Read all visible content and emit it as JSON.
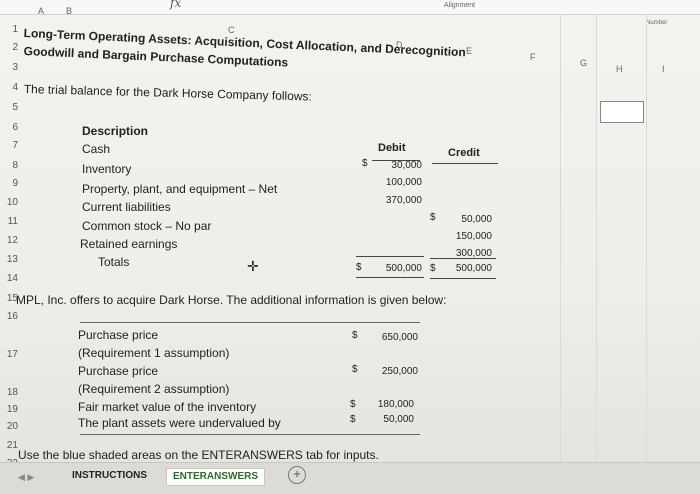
{
  "ribbon": {
    "formula_label": "fx",
    "alignment_label": "Alignment",
    "number_label": "Number"
  },
  "columns": [
    "A",
    "B",
    "C",
    "D",
    "E",
    "F",
    "G",
    "H",
    "I"
  ],
  "rows": [
    "1",
    "2",
    "3",
    "4",
    "5",
    "6",
    "7",
    "8",
    "9",
    "10",
    "11",
    "12",
    "13",
    "14",
    "15",
    "16",
    "17",
    "18",
    "19",
    "20",
    "21",
    "22"
  ],
  "heading": {
    "line1": "Long-Term Operating Assets: Acquisition, Cost Allocation, and Derecognition",
    "line2": "Goodwill and Bargain Purchase Computations"
  },
  "intro": "The trial balance for the Dark Horse Company follows:",
  "trial_balance": {
    "headers": {
      "description": "Description",
      "debit": "Debit",
      "credit": "Credit"
    },
    "rows": [
      {
        "description": "Cash",
        "debit_symbol": "$",
        "debit": "30,000",
        "credit_symbol": "",
        "credit": ""
      },
      {
        "description": "Inventory",
        "debit_symbol": "",
        "debit": "100,000",
        "credit_symbol": "",
        "credit": ""
      },
      {
        "description": "Property, plant, and equipment – Net",
        "debit_symbol": "",
        "debit": "370,000",
        "credit_symbol": "",
        "credit": ""
      },
      {
        "description": "Current liabilities",
        "debit_symbol": "",
        "debit": "",
        "credit_symbol": "$",
        "credit": "50,000"
      },
      {
        "description": "Common stock – No par",
        "debit_symbol": "",
        "debit": "",
        "credit_symbol": "",
        "credit": "150,000"
      },
      {
        "description": "Retained earnings",
        "debit_symbol": "",
        "debit": "",
        "credit_symbol": "",
        "credit": "300,000"
      },
      {
        "description": "Totals",
        "debit_symbol": "$",
        "debit": "500,000",
        "credit_symbol": "$",
        "credit": "500,000"
      }
    ]
  },
  "offer_text": "MPL, Inc. offers to acquire Dark Horse. The additional information is given below:",
  "additional": [
    {
      "label": "Purchase price",
      "symbol": "$",
      "value": "650,000"
    },
    {
      "label": "(Requirement 1 assumption)",
      "symbol": "",
      "value": ""
    },
    {
      "label": "Purchase price",
      "symbol": "$",
      "value": "250,000"
    },
    {
      "label": "(Requirement 2 assumption)",
      "symbol": "",
      "value": ""
    },
    {
      "label": "Fair market value of the inventory",
      "symbol": "$",
      "value": "180,000"
    },
    {
      "label": "The plant assets were undervalued by",
      "symbol": "$",
      "value": "50,000"
    }
  ],
  "footer_text": "Use the blue shaded areas on the ENTERANSWERS tab for inputs.",
  "tabs": [
    {
      "label": "INSTRUCTIONS"
    },
    {
      "label": "ENTERANSWERS"
    }
  ],
  "add_tab_symbol": "+",
  "nav_arrows": "◀ ▶"
}
